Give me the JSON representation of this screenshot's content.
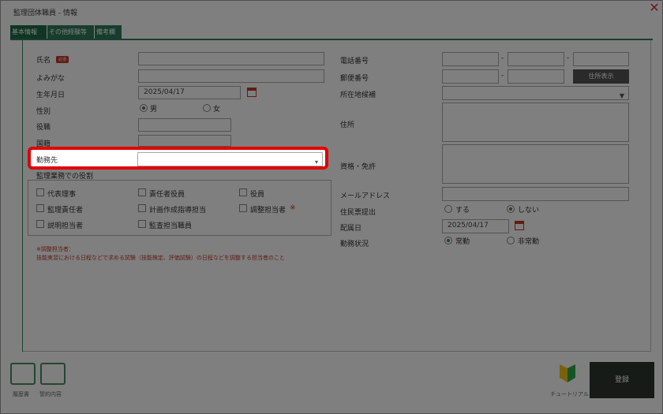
{
  "window": {
    "title": "監理団体職員 - 情報",
    "close_label": "✕"
  },
  "tabs": [
    {
      "label": "基本情報",
      "active": true
    },
    {
      "label": "その他経験等",
      "active": false
    },
    {
      "label": "備考欄",
      "active": false
    }
  ],
  "left": {
    "name_label": "氏名",
    "required_badge": "必須",
    "furigana_label": "よみがな",
    "birthdate_label": "生年月日",
    "birthdate_value": "2025/04/17",
    "gender_label": "性別",
    "gender_options": [
      "男",
      "女"
    ],
    "gender_selected": "男",
    "position_label": "役職",
    "nationality_label": "国籍",
    "workplace_label": "勤務先",
    "workplace_value": "",
    "roles_label": "監理業務での役割",
    "roles": [
      {
        "label": "代表理事",
        "checked": false
      },
      {
        "label": "責任者役員",
        "checked": false
      },
      {
        "label": "役員",
        "checked": false
      },
      {
        "label": "監理責任者",
        "checked": false
      },
      {
        "label": "計画作成指導担当",
        "checked": false
      },
      {
        "label": "調整担当者",
        "checked": false
      },
      {
        "label": "説明担当者",
        "checked": false
      },
      {
        "label": "監査担当職員",
        "checked": false
      }
    ],
    "roles_mark": "※",
    "note_line1": "※調整担当者：",
    "note_line2": "技能実習における日程などで求める試験（技能検定、評価試験）の日程などを調整する担当者のこと"
  },
  "right": {
    "phone_label": "電話番号",
    "dash": "-",
    "postal_label": "郵便番号",
    "address_button": "住所表示",
    "prefecture_label": "所在地候補",
    "address_label": "住所",
    "license_label": "資格・免許",
    "email_label": "メールアドレス",
    "resident_label": "住民票提出",
    "resident_options": [
      "する",
      "しない"
    ],
    "resident_selected": "しない",
    "assign_label": "配属日",
    "assign_value": "2025/04/17",
    "employment_label": "勤務状況",
    "employment_options": [
      "常勤",
      "非常勤"
    ],
    "employment_selected": "常勤"
  },
  "footer": {
    "print_label": "履歴書",
    "apply_label": "誓約内容",
    "tutorial_label": "チュートリアル",
    "register_label": "登録"
  },
  "colors": {
    "accent": "#2e7d5b",
    "highlight": "#e00000",
    "required": "#c0392b",
    "register_bg": "#2c3631"
  }
}
